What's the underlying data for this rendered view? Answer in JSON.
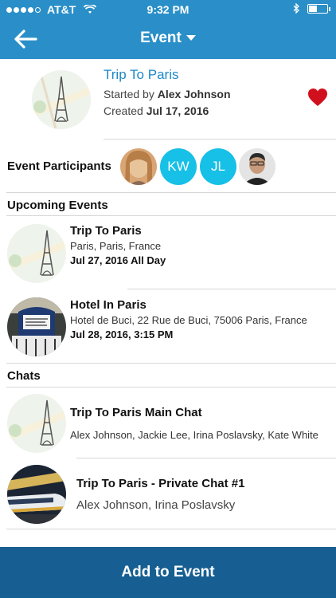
{
  "status_bar": {
    "carrier": "AT&T",
    "time": "9:32 PM"
  },
  "nav": {
    "title": "Event"
  },
  "event": {
    "title": "Trip To Paris",
    "started_prefix": "Started by",
    "started_by": "Alex Johnson",
    "created_prefix": "Created",
    "created_date": "Jul 17, 2016"
  },
  "participants": {
    "label": "Event Participants",
    "initials": [
      "KW",
      "JL"
    ]
  },
  "upcoming": {
    "label": "Upcoming Events",
    "items": [
      {
        "title": "Trip To Paris",
        "location": "Paris, Paris, France",
        "date": "Jul 27, 2016 All Day"
      },
      {
        "title": "Hotel In Paris",
        "location": "Hotel de Buci, 22 Rue de Buci, 75006 Paris, France",
        "date": "Jul 28, 2016, 3:15 PM"
      }
    ]
  },
  "chats": {
    "label": "Chats",
    "items": [
      {
        "title": "Trip To Paris Main Chat",
        "members": "Alex Johnson, Jackie Lee, Irina Poslavsky, Kate White"
      },
      {
        "title": "Trip To Paris - Private Chat #1",
        "members": "Alex Johnson, Irina Poslavsky"
      }
    ]
  },
  "bottom": {
    "button_label": "Add to Event"
  },
  "colors": {
    "header_blue": "#2a8fc8",
    "accent_blue": "#1e88c7",
    "avatar_cyan": "#16c0e6",
    "heart_red": "#d0101d",
    "bottom_blue": "#175f92"
  }
}
